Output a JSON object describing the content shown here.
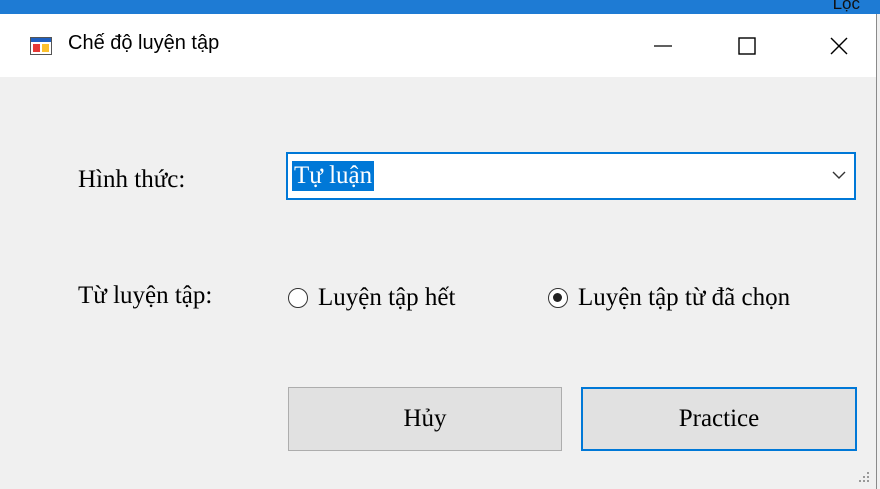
{
  "background_app": {
    "text": "Lọc"
  },
  "window": {
    "title": "Chế độ luyện tập"
  },
  "form": {
    "hinhthuc_label": "Hình thức:",
    "hinhthuc_value": "Tự luận",
    "tuluyentap_label": "Từ luyện tập:",
    "radio_all_label": "Luyện tập hết",
    "radio_selected_label": "Luyện tập từ đã chọn",
    "selected_option": "Luyện tập từ đã chọn"
  },
  "buttons": {
    "cancel": "Hủy",
    "practice": "Practice"
  },
  "colors": {
    "accent": "#0078d7",
    "button_face": "#e1e1e1",
    "window_bg": "#f0f0f0",
    "titlebar_bg": "#ffffff"
  },
  "icons": {
    "app": "app-form-icon",
    "minimize": "minimize-icon",
    "maximize": "maximize-icon",
    "close": "close-icon",
    "dropdown": "chevron-down-icon"
  }
}
